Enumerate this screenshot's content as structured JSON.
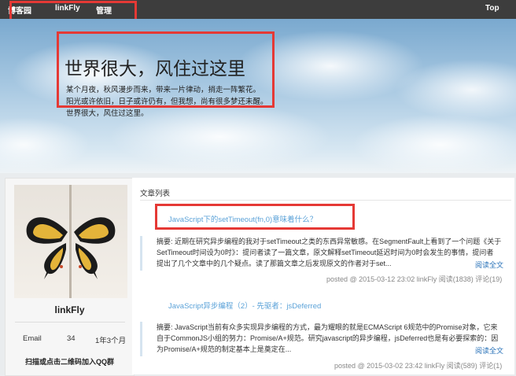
{
  "nav": {
    "items": [
      "博客园",
      "linkFly",
      "管理"
    ],
    "top_label": "Top"
  },
  "hero": {
    "title": "世界很大，风住过这里",
    "lines": [
      "某个月夜，秋风漫步而来，带来一片律动，捎走一阵繁花。",
      "阳光或许依旧，日子或许仍有，但我想，尚有很多梦还未醒。",
      "世界很大，风住过这里。"
    ]
  },
  "sidebar": {
    "name": "linkFly",
    "stats": [
      "Email",
      "34",
      "1年3个月"
    ],
    "qr_hint": "扫描或点击二维码加入QQ群"
  },
  "main": {
    "section_title": "文章列表",
    "posts": [
      {
        "title": "JavaScript下的setTimeout(fn,0)意味着什么？",
        "excerpt_lines": [
          "摘要: 近期在研究异步编程的我对于setTimeout之类的东西异常敏感。在SegmentFault上看到了一个问题《关于",
          "SetTimeout时间设为0时》：提问者读了一篇文章，原文解释setTimeout延迟时间为0时会发生的事情，提问者",
          "提出了几个文章中的几个疑点。读了那篇文章之后发现原文的作者对于set..."
        ],
        "read_more": "阅读全文",
        "meta": "posted @ 2015-03-12 23:02 linkFly 阅读(1838) 评论(19)"
      },
      {
        "title": "JavaScript异步编程（2）- 先驱者：jsDeferred",
        "excerpt_lines": [
          "摘要: JavaScript当前有众多实现异步编程的方式，最为耀眼的就是ECMAScript 6规范中的Promise对象，它来",
          "自于CommonJS小组的努力：Promise/A+规范。研究javascript的异步编程，jsDeferred也是有必要探索的：因",
          "为Promise/A+规范的制定基本上是奠定在..."
        ],
        "read_more": "阅读全文",
        "meta": "posted @ 2015-03-02 23:42 linkFly 阅读(589) 评论(1)"
      }
    ]
  },
  "colors": {
    "nav_bg": "#3d3d3d",
    "link": "#5ba2d8",
    "highlight_box": "#e53935"
  }
}
